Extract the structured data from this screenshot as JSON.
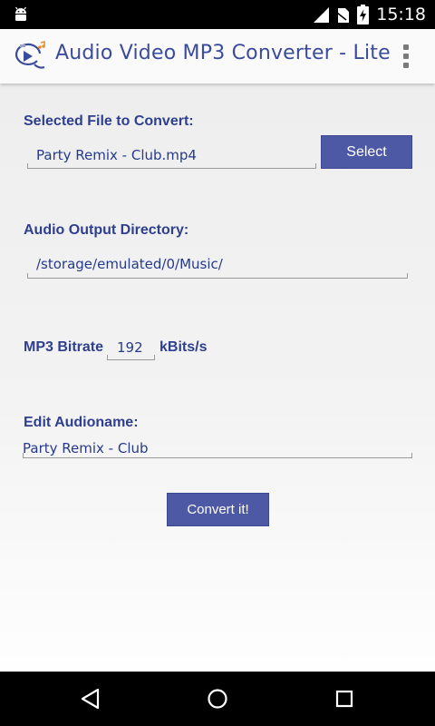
{
  "status_bar": {
    "time": "15:18",
    "icons": [
      "android-icon",
      "signal-icon",
      "no-sim-icon",
      "battery-charging-icon"
    ]
  },
  "app_bar": {
    "title": "Audio Video MP3 Converter - Lite",
    "icons": [
      "app-logo-icon",
      "overflow-menu-icon"
    ]
  },
  "form": {
    "selected_file_label": "Selected File to Convert:",
    "selected_file_value": "Party Remix - Club.mp4",
    "select_button": "Select",
    "output_dir_label": "Audio Output Directory:",
    "output_dir_value": "/storage/emulated/0/Music/",
    "bitrate_label": "MP3 Bitrate",
    "bitrate_value": "192",
    "bitrate_unit": "kBits/s",
    "audioname_label": "Edit Audioname:",
    "audioname_value": "Party Remix - Club",
    "convert_button": "Convert it!"
  },
  "colors": {
    "accent": "#3b4b9b",
    "button": "#4d59a5"
  },
  "nav_bar": {
    "icons": [
      "back-icon",
      "home-icon",
      "recents-icon"
    ]
  }
}
